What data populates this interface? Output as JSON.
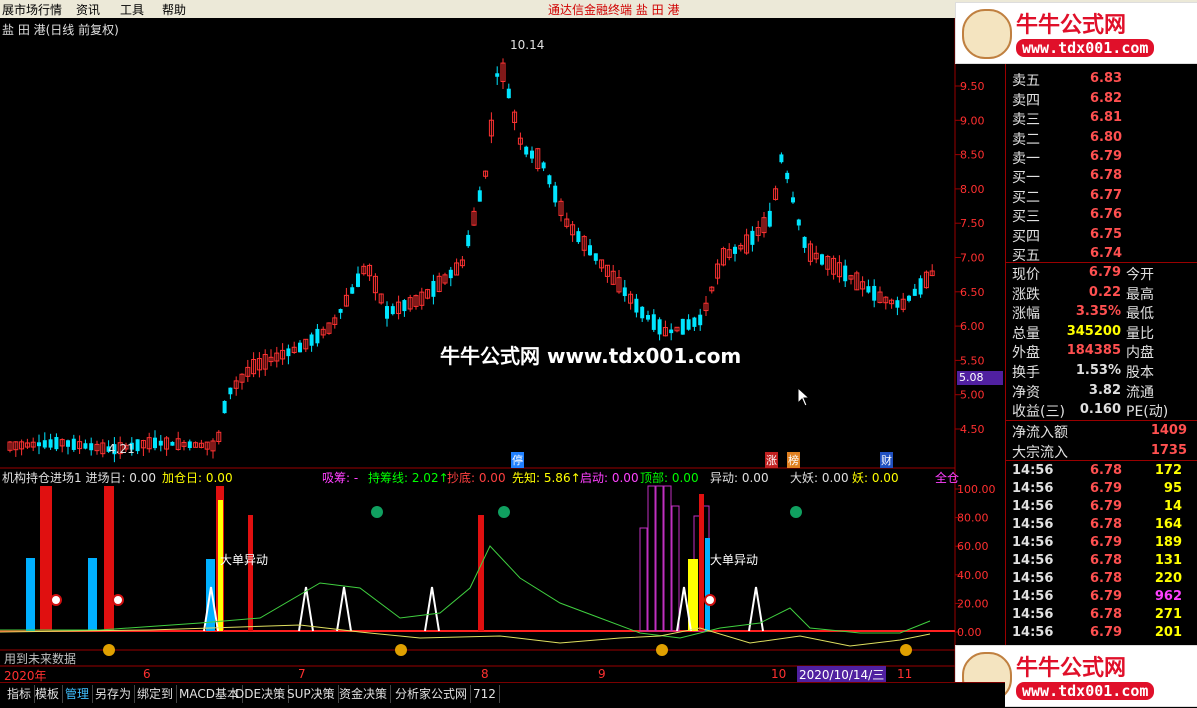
{
  "menu": {
    "items": [
      "展市场行情",
      "资讯",
      "工具",
      "帮助"
    ],
    "app_title": "通达信金融终端   盐 田 港"
  },
  "chart": {
    "title": "盐 田 港(日线 前复权)",
    "high_label": "10.14",
    "low_label": "4.21",
    "overlay_text": "牛牛公式网 www.tdx001.com",
    "price_axis": [
      "9.50",
      "9.00",
      "8.50",
      "8.00",
      "7.50",
      "7.00",
      "6.50",
      "6.00",
      "5.50",
      "5.00",
      "4.50"
    ],
    "cursor_price": "5.08",
    "event_tags": [
      "停",
      "涨",
      "榜",
      "财"
    ],
    "up_color": "#ff3232",
    "down_color": "#00e5ff"
  },
  "indicator": {
    "labels": [
      {
        "text": "机构持仓进场1  进场日: 0.00",
        "color": "#e0e0e0"
      },
      {
        "text": "加仓日: 0.00",
        "color": "#ffff00"
      },
      {
        "text": "吸筹: -",
        "color": "#ff40ff"
      },
      {
        "text": "持筹线: 2.02↑",
        "color": "#00ff00"
      },
      {
        "text": "抄底: 0.00",
        "color": "#ff4040"
      },
      {
        "text": "先知: 5.86↑",
        "color": "#ffff00"
      },
      {
        "text": "启动: 0.00",
        "color": "#ff40ff"
      },
      {
        "text": "顶部: 0.00",
        "color": "#00ff00"
      },
      {
        "text": "异动: 0.00",
        "color": "#e0e0e0"
      },
      {
        "text": "大妖: 0.00",
        "color": "#e0e0e0"
      },
      {
        "text": "妖: 0.00",
        "color": "#ffff00"
      },
      {
        "text": "全仓",
        "color": "#ff40ff"
      }
    ],
    "axis": [
      "100.00",
      "80.00",
      "60.00",
      "40.00",
      "20.00",
      "0.00"
    ],
    "annot1": "大单异动",
    "annot2": "大单异动",
    "future_note": "用到未来数据"
  },
  "time_axis": {
    "labels": [
      "2020年",
      "6",
      "7",
      "8",
      "9",
      "10",
      "11"
    ],
    "cursor_date": "2020/10/14/三"
  },
  "quote": {
    "asks": [
      {
        "label": "卖五",
        "price": "6.83"
      },
      {
        "label": "卖四",
        "price": "6.82"
      },
      {
        "label": "卖三",
        "price": "6.81"
      },
      {
        "label": "卖二",
        "price": "6.80"
      },
      {
        "label": "卖一",
        "price": "6.79"
      }
    ],
    "bids": [
      {
        "label": "买一",
        "price": "6.78"
      },
      {
        "label": "买二",
        "price": "6.77"
      },
      {
        "label": "买三",
        "price": "6.76"
      },
      {
        "label": "买四",
        "price": "6.75"
      },
      {
        "label": "买五",
        "price": "6.74"
      }
    ],
    "stats": [
      {
        "l1": "现价",
        "v1": "6.79",
        "c1": "#ff5050",
        "l2": "今开"
      },
      {
        "l1": "涨跌",
        "v1": "0.22",
        "c1": "#ff5050",
        "l2": "最高"
      },
      {
        "l1": "涨幅",
        "v1": "3.35%",
        "c1": "#ff5050",
        "l2": "最低"
      },
      {
        "l1": "总量",
        "v1": "345200",
        "c1": "#ffff00",
        "l2": "量比"
      },
      {
        "l1": "外盘",
        "v1": "184385",
        "c1": "#ff5050",
        "l2": "内盘"
      },
      {
        "l1": "换手",
        "v1": "1.53%",
        "c1": "#e0e0e0",
        "l2": "股本"
      },
      {
        "l1": "净资",
        "v1": "3.82",
        "c1": "#e0e0e0",
        "l2": "流通"
      },
      {
        "l1": "收益(三)",
        "v1": "0.160",
        "c1": "#e0e0e0",
        "l2": "PE(动)"
      }
    ],
    "flows": [
      {
        "label": "净流入额",
        "value": "1409"
      },
      {
        "label": "大宗流入",
        "value": "1735"
      }
    ],
    "ticks": [
      {
        "t": "14:56",
        "p": "6.78",
        "v": "172",
        "c": "#ffff00"
      },
      {
        "t": "14:56",
        "p": "6.79",
        "v": "95",
        "c": "#ffff00"
      },
      {
        "t": "14:56",
        "p": "6.79",
        "v": "14",
        "c": "#ffff00"
      },
      {
        "t": "14:56",
        "p": "6.78",
        "v": "164",
        "c": "#ffff00"
      },
      {
        "t": "14:56",
        "p": "6.79",
        "v": "189",
        "c": "#ffff00"
      },
      {
        "t": "14:56",
        "p": "6.78",
        "v": "131",
        "c": "#ffff00"
      },
      {
        "t": "14:56",
        "p": "6.78",
        "v": "220",
        "c": "#ffff00"
      },
      {
        "t": "14:56",
        "p": "6.79",
        "v": "962",
        "c": "#ff40ff"
      },
      {
        "t": "14:56",
        "p": "6.78",
        "v": "271",
        "c": "#ffff00"
      },
      {
        "t": "14:56",
        "p": "6.79",
        "v": "201",
        "c": "#ffff00"
      }
    ]
  },
  "watermark": {
    "cn": "牛牛公式网",
    "url": "www.tdx001.com"
  },
  "bottom_tabs": [
    "指标",
    "模板",
    "管理",
    "另存为",
    "绑定到",
    "MACD基本",
    "DDE决策",
    "SUP决策",
    "资金决策",
    "分析家公式网",
    "712"
  ]
}
